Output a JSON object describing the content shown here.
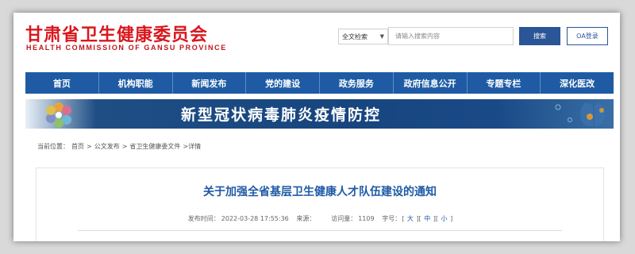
{
  "header": {
    "logo_cn": "甘肃省卫生健康委员会",
    "logo_en": "HEALTH COMMISSION OF GANSU PROVINCE",
    "search_scope": "全文检索",
    "search_placeholder": "请输入搜索内容",
    "search_button": "搜索",
    "oa_button": "OA登录"
  },
  "nav": {
    "items": [
      "首页",
      "机构职能",
      "新闻发布",
      "党的建设",
      "政务服务",
      "政府信息公开",
      "专题专栏",
      "深化医改"
    ]
  },
  "banner": {
    "title": "新型冠状病毒肺炎疫情防控"
  },
  "breadcrumb": {
    "label": "当前位置：",
    "home": "首页",
    "sep": ">",
    "c1": "公文发布",
    "c2": "省卫生健康委文件",
    "c3": ">详情"
  },
  "article": {
    "title": "关于加强全省基层卫生健康人才队伍建设的通知",
    "publish_label": "发布时间：",
    "publish_time": "2022-03-28 17:55:36",
    "source_label": "来源：",
    "visits_label": "访问量：",
    "visits": "1109",
    "fontsize_label": "字号：",
    "size_large": "大",
    "size_medium": "中",
    "size_small": "小"
  },
  "colors": {
    "brand_red": "#d9171e",
    "nav_blue": "#1e5ba4",
    "title_blue": "#1f5aa6"
  }
}
